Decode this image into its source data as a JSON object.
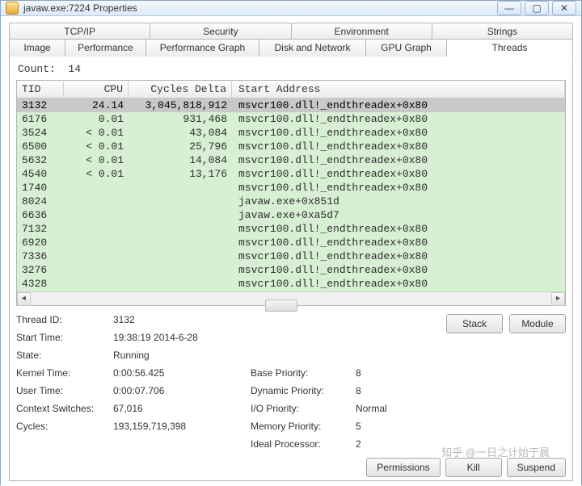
{
  "window": {
    "title": "javaw.exe:7224 Properties",
    "icon_name": "java-icon",
    "buttons": {
      "minimize": "—",
      "maximize": "▢",
      "close": "✕"
    }
  },
  "tabs_row1": [
    "TCP/IP",
    "Security",
    "Environment",
    "Strings"
  ],
  "tabs_row2": [
    "Image",
    "Performance",
    "Performance Graph",
    "Disk and Network",
    "GPU Graph",
    "Threads"
  ],
  "active_tab": "Threads",
  "count_label": "Count:",
  "count_value": "14",
  "columns": {
    "tid": "TID",
    "cpu": "CPU",
    "cycles": "Cycles Delta",
    "addr": "Start Address"
  },
  "sort_column": "cpu",
  "rows": [
    {
      "tid": "3132",
      "cpu": "24.14",
      "cycles": "3,045,818,912",
      "addr": "msvcr100.dll!_endthreadex+0x80",
      "selected": true
    },
    {
      "tid": "6176",
      "cpu": "0.01",
      "cycles": "931,468",
      "addr": "msvcr100.dll!_endthreadex+0x80"
    },
    {
      "tid": "3524",
      "cpu": "< 0.01",
      "cycles": "43,084",
      "addr": "msvcr100.dll!_endthreadex+0x80"
    },
    {
      "tid": "6500",
      "cpu": "< 0.01",
      "cycles": "25,796",
      "addr": "msvcr100.dll!_endthreadex+0x80"
    },
    {
      "tid": "5632",
      "cpu": "< 0.01",
      "cycles": "14,084",
      "addr": "msvcr100.dll!_endthreadex+0x80"
    },
    {
      "tid": "4540",
      "cpu": "< 0.01",
      "cycles": "13,176",
      "addr": "msvcr100.dll!_endthreadex+0x80"
    },
    {
      "tid": "1740",
      "cpu": "",
      "cycles": "",
      "addr": "msvcr100.dll!_endthreadex+0x80"
    },
    {
      "tid": "8024",
      "cpu": "",
      "cycles": "",
      "addr": "javaw.exe+0x851d"
    },
    {
      "tid": "6636",
      "cpu": "",
      "cycles": "",
      "addr": "javaw.exe+0xa5d7"
    },
    {
      "tid": "7132",
      "cpu": "",
      "cycles": "",
      "addr": "msvcr100.dll!_endthreadex+0x80"
    },
    {
      "tid": "6920",
      "cpu": "",
      "cycles": "",
      "addr": "msvcr100.dll!_endthreadex+0x80"
    },
    {
      "tid": "7336",
      "cpu": "",
      "cycles": "",
      "addr": "msvcr100.dll!_endthreadex+0x80"
    },
    {
      "tid": "3276",
      "cpu": "",
      "cycles": "",
      "addr": "msvcr100.dll!_endthreadex+0x80"
    },
    {
      "tid": "4328",
      "cpu": "",
      "cycles": "",
      "addr": "msvcr100.dll!_endthreadex+0x80"
    }
  ],
  "details": {
    "labels1": [
      "Thread ID:",
      "Start Time:",
      "State:",
      "Kernel Time:",
      "User Time:",
      "Context Switches:",
      "Cycles:"
    ],
    "values1": [
      "3132",
      "19:38:19   2014-6-28",
      "Running",
      "0:00:56.425",
      "0:00:07.706",
      "67,016",
      "193,159,719,398"
    ],
    "labels2": [
      "",
      "",
      "",
      "Base Priority:",
      "Dynamic Priority:",
      "I/O Priority:",
      "Memory Priority:",
      "Ideal Processor:"
    ],
    "values2": [
      "",
      "",
      "",
      "8",
      "8",
      "Normal",
      "5",
      "2"
    ]
  },
  "buttons": {
    "stack": "Stack",
    "module": "Module",
    "permissions": "Permissions",
    "kill": "Kill",
    "suspend": "Suspend"
  },
  "watermark": "知乎 @一日之计始于晨"
}
